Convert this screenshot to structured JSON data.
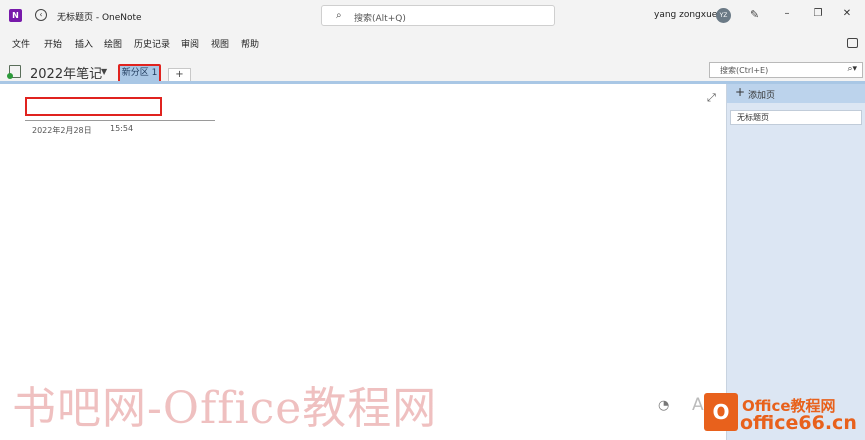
{
  "titlebar": {
    "app_icon_letter": "N",
    "window_title": "无标题页 - OneNote",
    "search_placeholder": "搜索(Alt+Q)",
    "user_name": "yang zongxue",
    "avatar_initials": "YZ"
  },
  "menu": {
    "items": [
      "文件",
      "开始",
      "插入",
      "绘图",
      "历史记录",
      "审阅",
      "视图",
      "帮助"
    ]
  },
  "notebook": {
    "name": "2022年笔记",
    "section_tab": "新分区 1",
    "add_section": "+",
    "page_search_placeholder": "搜索(Ctrl+E)"
  },
  "page": {
    "title": "",
    "date": "2022年2月28日",
    "time": "15:54"
  },
  "pagelist": {
    "add_page_label": "添加页",
    "pages": [
      "无标题页"
    ]
  },
  "watermark": {
    "main": "书吧网-Office教程网",
    "partial": "A",
    "brand_line1": "Office教程网",
    "brand_line2": "office66.cn"
  },
  "colors": {
    "accent_section": "#a9c7e5",
    "highlight_box": "#e0231f",
    "pagelist_bg": "#dce6f3",
    "onenote_purple": "#7719aa",
    "brand_orange": "#e8611c"
  },
  "icons": {
    "back": "back-icon",
    "search": "search-icon",
    "pen": "pen-icon",
    "expand": "expand-icon",
    "add_page": "plus-icon"
  }
}
